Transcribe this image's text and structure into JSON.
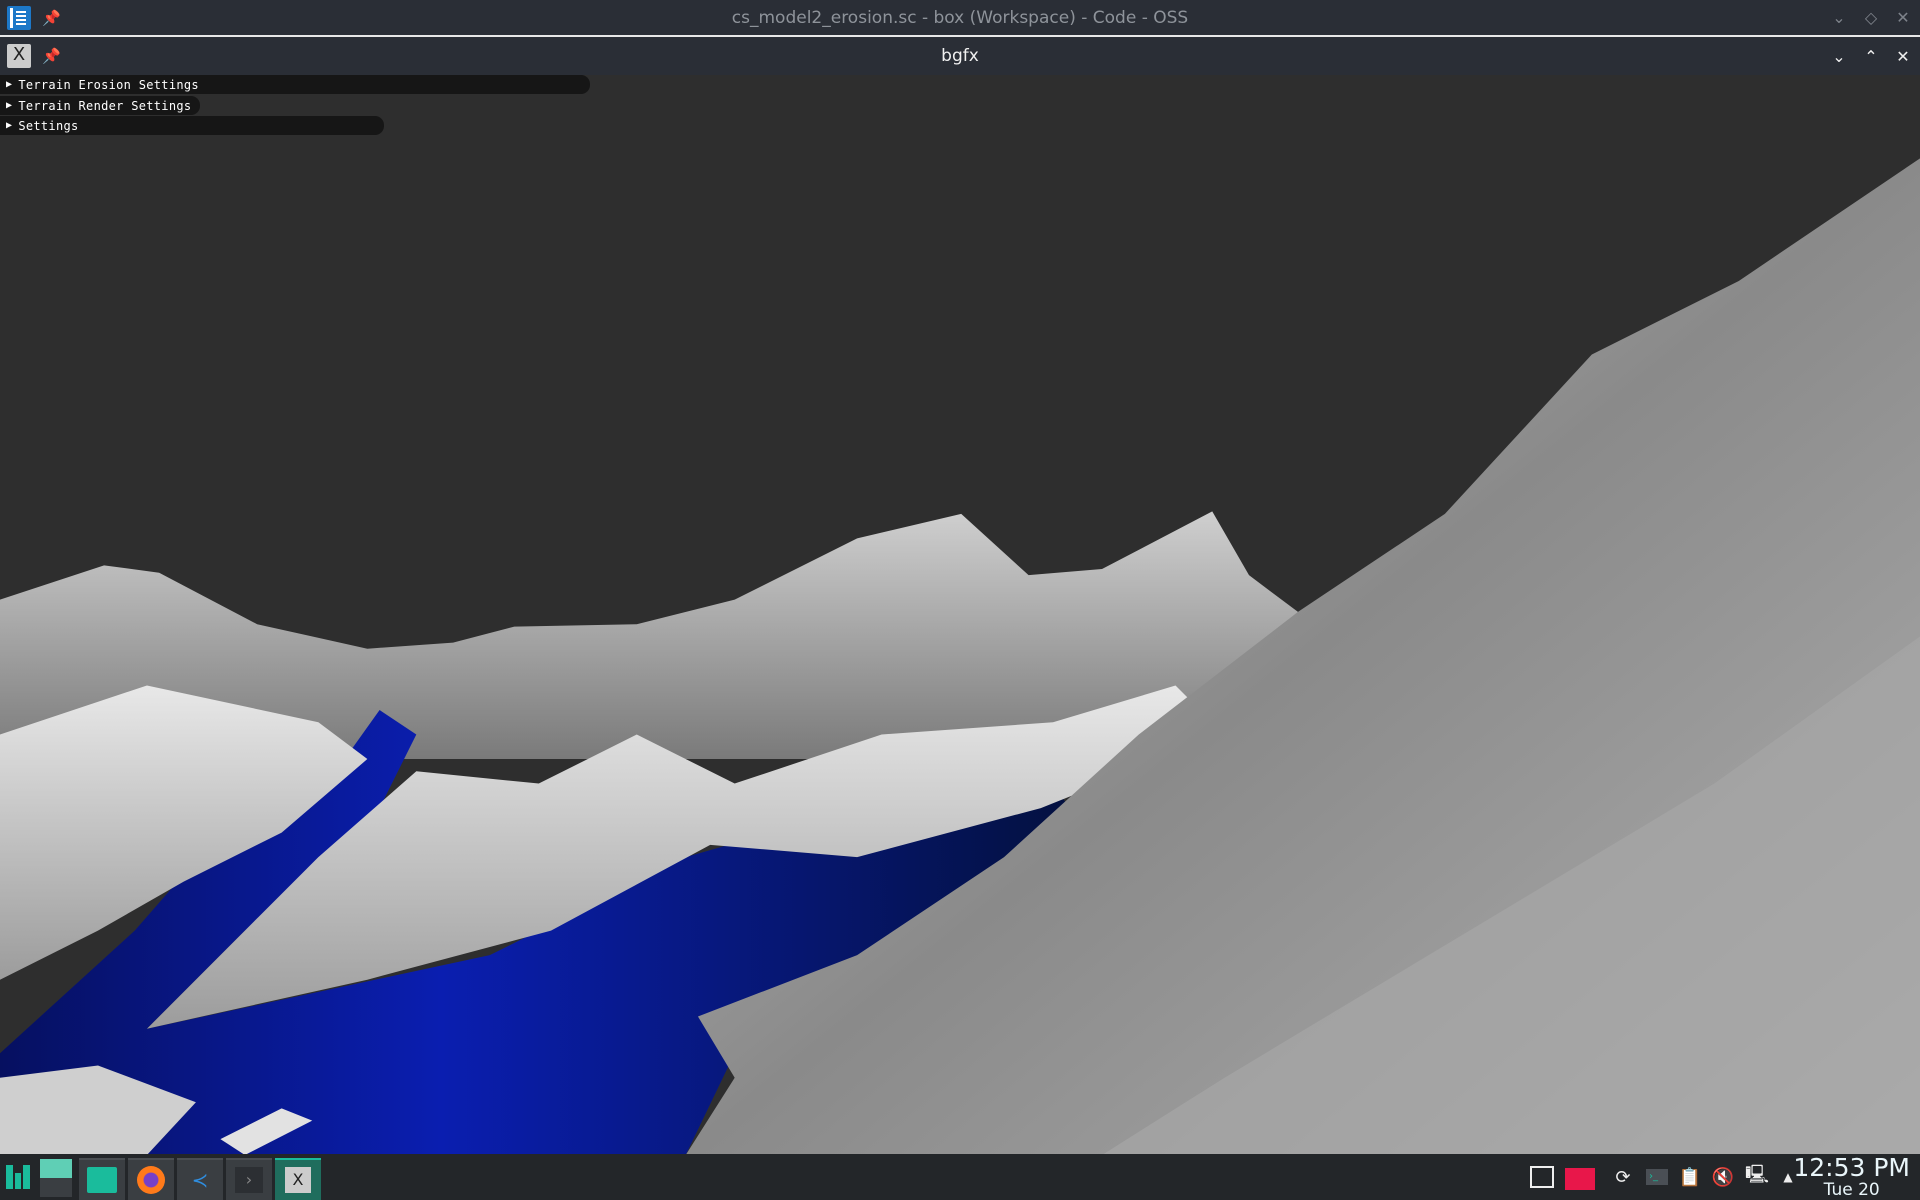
{
  "editor_window": {
    "title": "cs_model2_erosion.sc - box (Workspace) - Code - OSS",
    "icon": "kate-editor-icon",
    "controls": [
      "chevron-down-icon",
      "diamond-icon",
      "close-icon"
    ]
  },
  "bgfx_window": {
    "title": "bgfx",
    "icon": "x11-app-icon",
    "controls": [
      "chevron-down-icon",
      "chevron-up-icon",
      "close-icon"
    ]
  },
  "imgui_panels": [
    {
      "label": "Terrain Erosion Settings",
      "expanded": false
    },
    {
      "label": "Terrain Render Settings",
      "expanded": false
    },
    {
      "label": "Settings",
      "expanded": false
    }
  ],
  "scene": {
    "description_colors": {
      "sky": "#2e2e2e",
      "snow": "#d8d8d8",
      "water": "#0a1a9a",
      "slope": "#9a9a9a"
    }
  },
  "taskbar": {
    "launchers": [
      "manjaro-menu-icon",
      "desktop-pager-icon",
      "file-manager-icon",
      "firefox-icon",
      "vscode-icon",
      "terminal-icon",
      "x11-app-icon"
    ],
    "tray": [
      "show-desktop-icon",
      "trash-icon",
      "update-icon",
      "konsole-icon",
      "clipboard-icon",
      "volume-muted-icon",
      "network-icon",
      "tray-expand-icon"
    ],
    "clock": {
      "time": "12:53 PM",
      "date": "Tue 20"
    },
    "accent": "#1abc9c"
  }
}
